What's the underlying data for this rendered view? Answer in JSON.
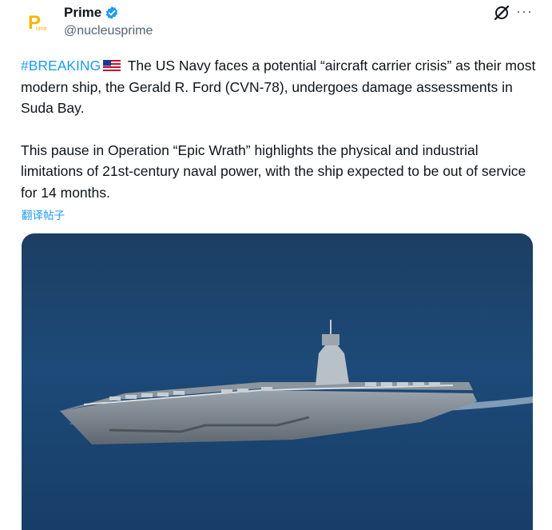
{
  "author": {
    "display_name": "Prime",
    "handle": "@nucleusprime",
    "avatar_letter": "P",
    "avatar_small_text": "rime",
    "brand_color": "#f5b800"
  },
  "post": {
    "hashtag": "#BREAKING",
    "paragraph1_rest": " The US Navy faces a potential “aircraft carrier crisis” as their most modern ship, the Gerald R. Ford (CVN-78), undergoes damage assessments in Suda Bay.",
    "paragraph2": "This pause in Operation “Epic Wrath” highlights the physical and industrial limitations of 21st-century naval power, with the ship expected to be out of service for 14 months.",
    "translate_label": "翻译帖子"
  },
  "icons": {
    "verified": "verified-badge-icon",
    "grok": "grok-icon",
    "more": "more-options-icon",
    "flag": "us-flag-icon"
  },
  "colors": {
    "link": "#1d9bf0",
    "text": "#0f1419",
    "secondary": "#536471",
    "sea": "#1d4a78"
  },
  "symbols": {
    "more": "···"
  }
}
